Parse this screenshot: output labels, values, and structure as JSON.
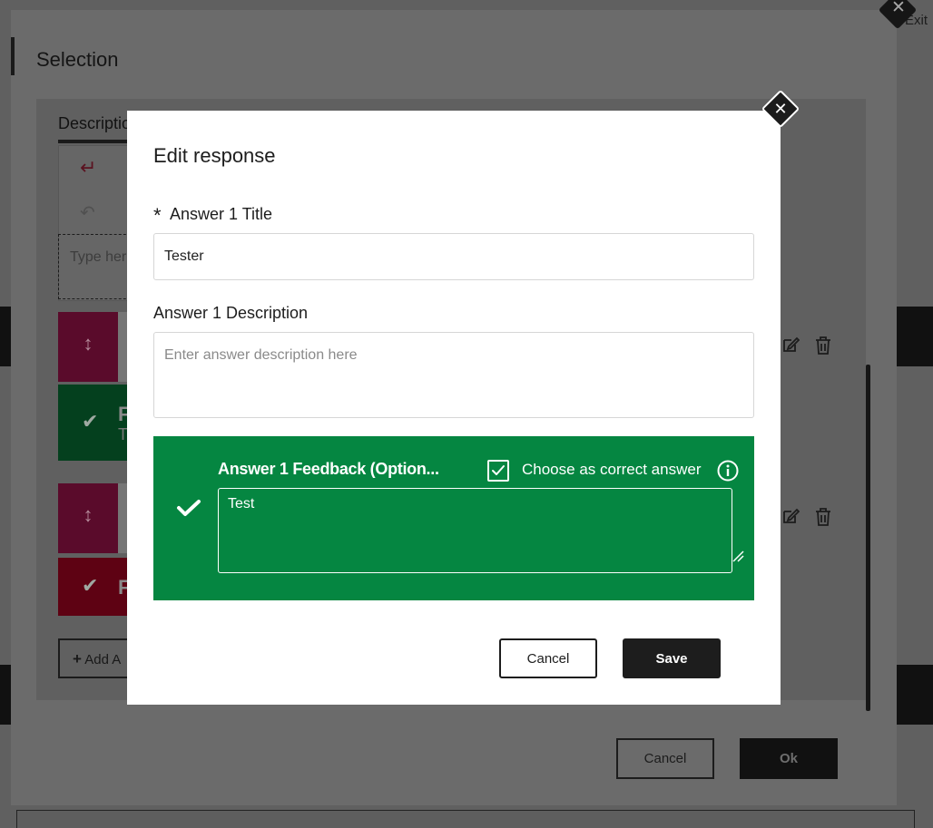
{
  "background": {
    "exit_label": "Exit"
  },
  "outer_dialog": {
    "title": "Selection",
    "tab_label": "Descriptio",
    "editor_placeholder": "Type her",
    "responses": [
      {
        "check_icon": "check-icon",
        "letter": "F",
        "sub": "T",
        "color": "#04401e"
      },
      {
        "check_icon": "check-icon",
        "letter": "F",
        "sub": "",
        "color": "#5e0213"
      }
    ],
    "add_label": "Add A",
    "cancel_label": "Cancel",
    "ok_label": "Ok"
  },
  "modal": {
    "title": "Edit response",
    "required_marker": "*",
    "title_label": "Answer 1 Title",
    "title_value": "Tester",
    "description_label": "Answer 1 Description",
    "description_placeholder": "Enter answer description here",
    "feedback_label": "Answer 1 Feedback (Option...",
    "correct_answer_label": "Choose as correct answer",
    "correct_answer_checked": true,
    "feedback_value": "Test",
    "cancel_label": "Cancel",
    "save_label": "Save",
    "accent_color": "#058641"
  }
}
